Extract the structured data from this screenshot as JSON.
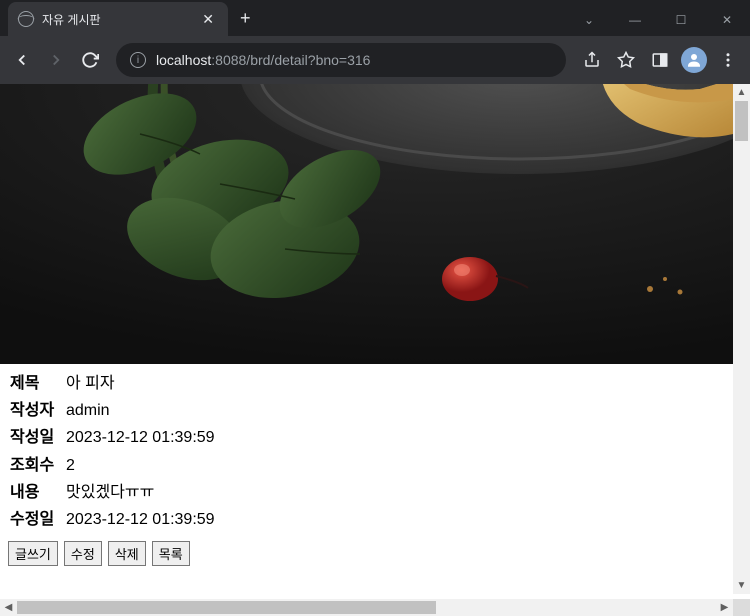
{
  "browser": {
    "tab_title": "자유 게시판",
    "url_host": "localhost",
    "url_port_path": ":8088/brd/detail?bno=316"
  },
  "post": {
    "title_label": "제목",
    "title_value": "아 피자",
    "author_label": "작성자",
    "author_value": "admin",
    "created_label": "작성일",
    "created_value": "2023-12-12 01:39:59",
    "views_label": "조회수",
    "views_value": "2",
    "content_label": "내용",
    "content_value": "맛있겠다ㅠㅠ",
    "modified_label": "수정일",
    "modified_value": "2023-12-12 01:39:59"
  },
  "buttons": {
    "write": "글쓰기",
    "edit": "수정",
    "delete": "삭제",
    "list": "목록"
  }
}
